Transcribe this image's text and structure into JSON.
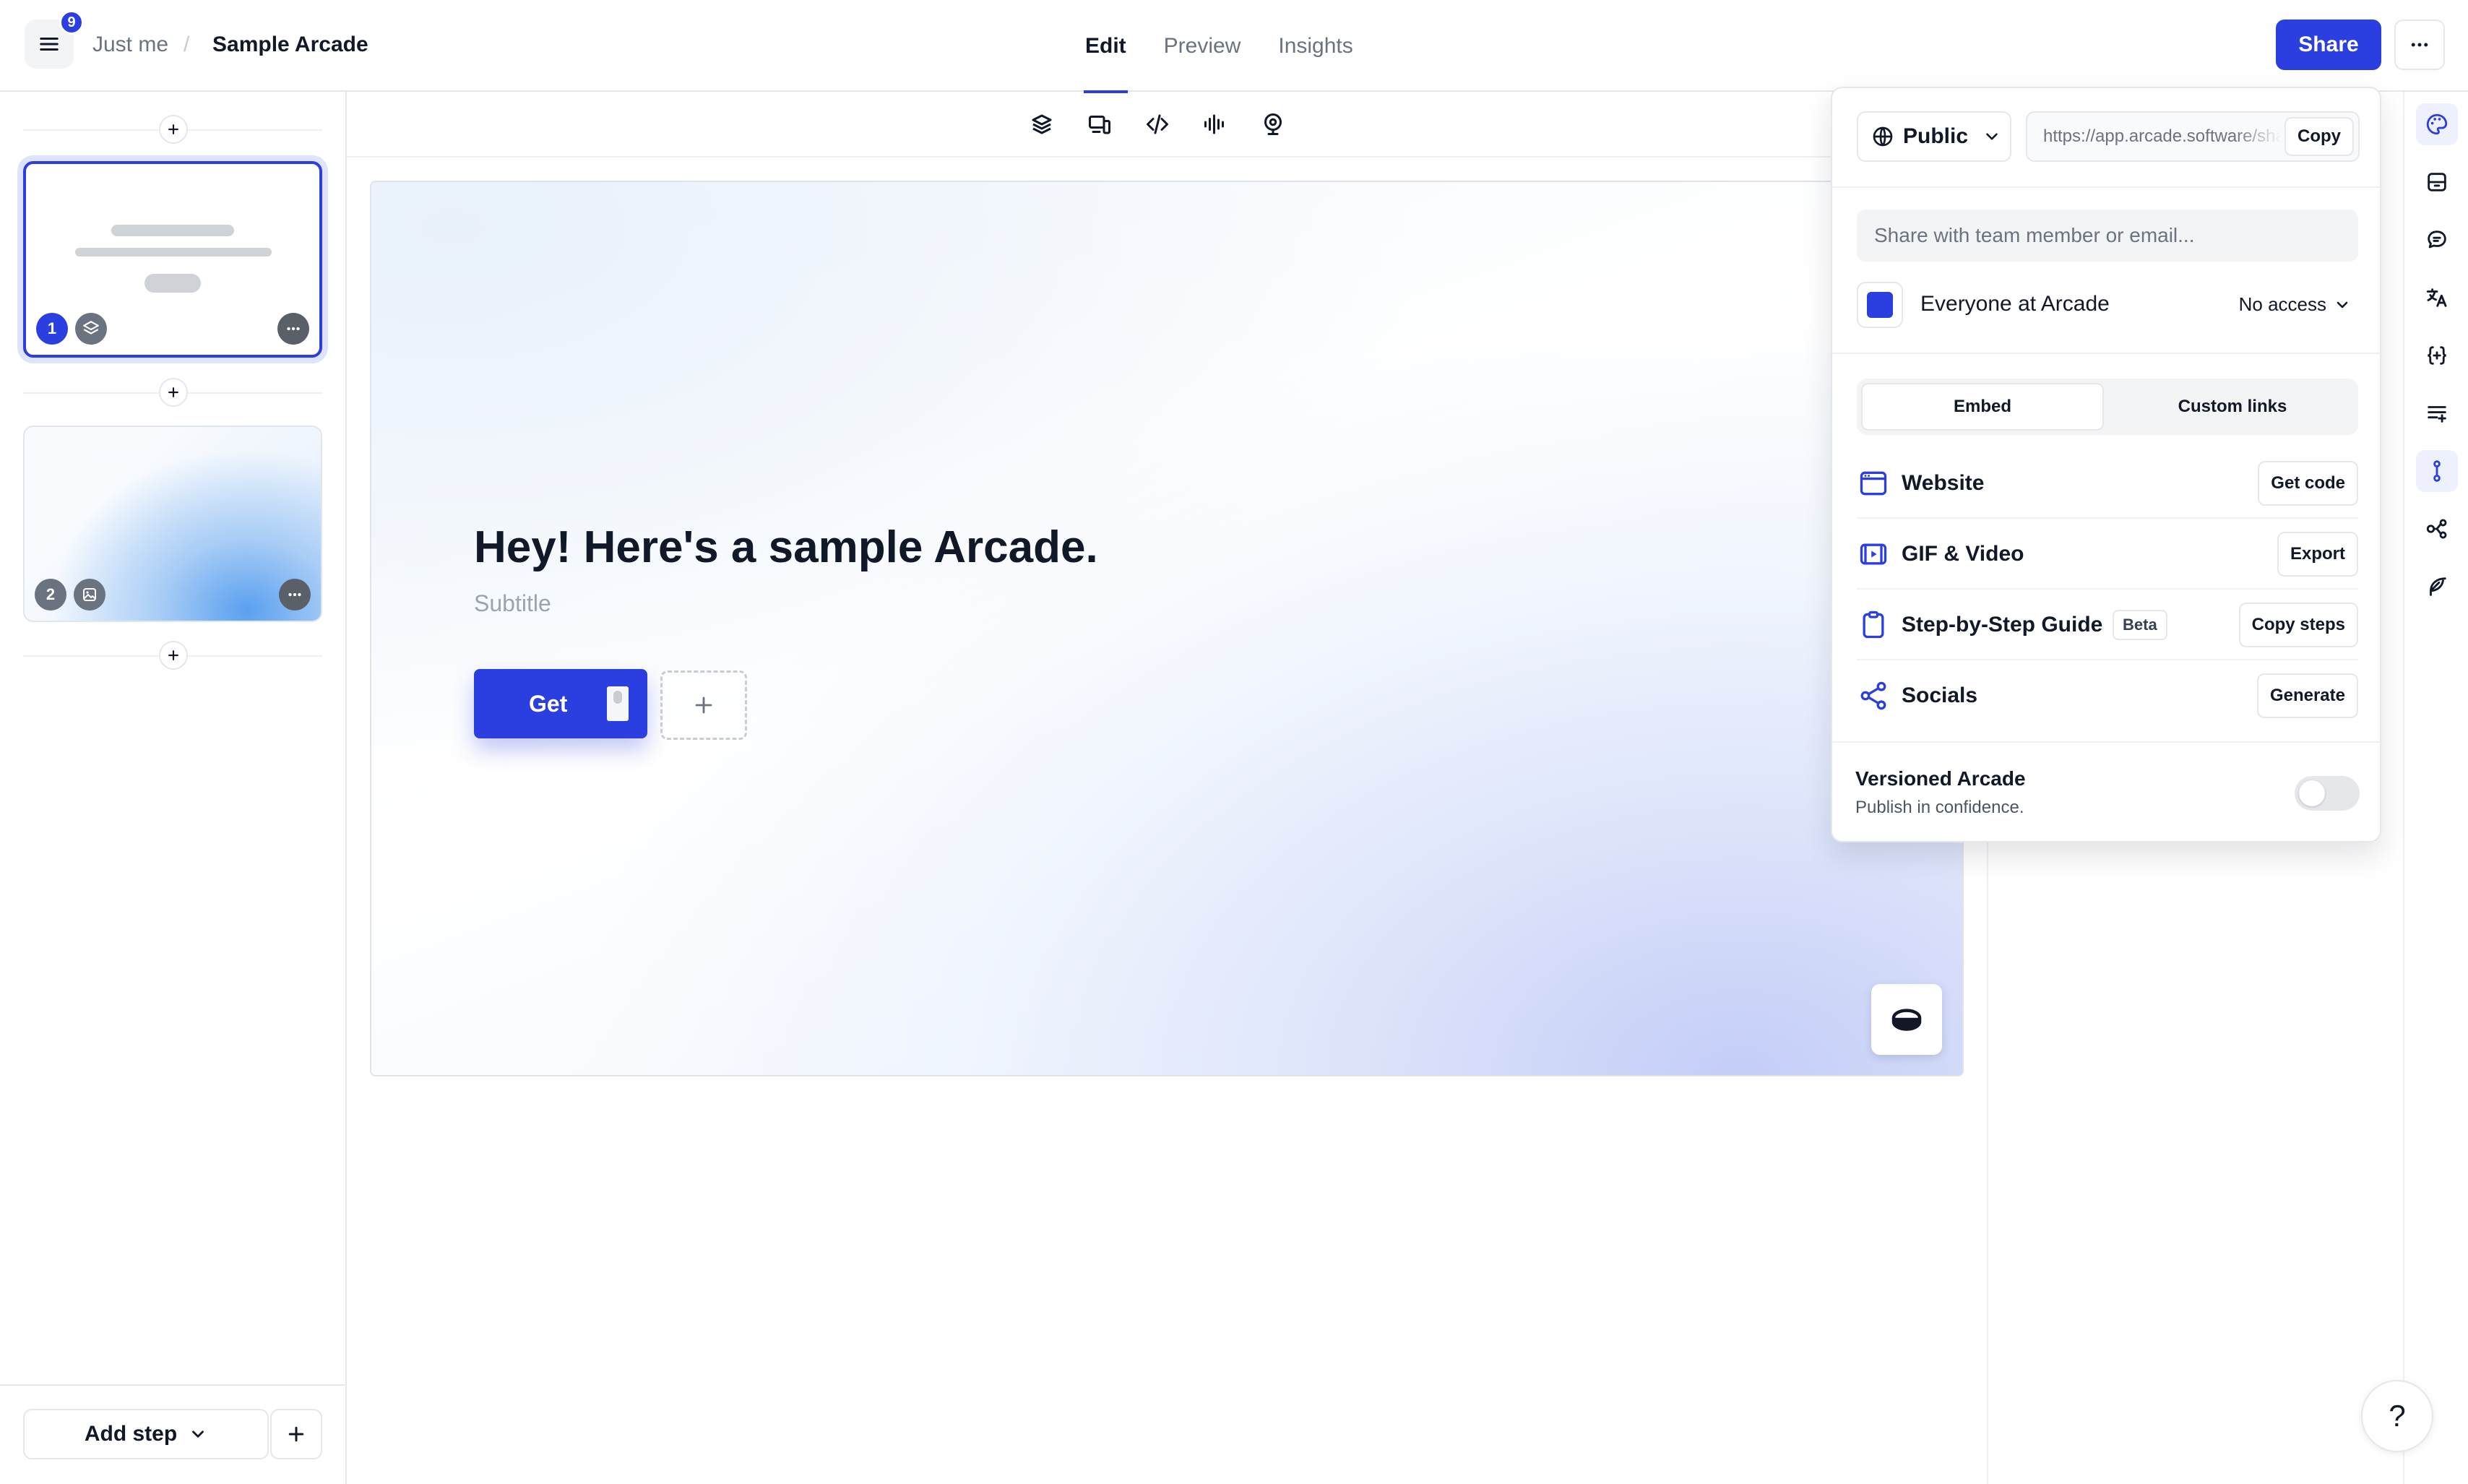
{
  "header": {
    "notification_count": "9",
    "workspace": "Just me",
    "separator": "/",
    "arcade_name": "Sample Arcade",
    "tabs": [
      {
        "label": "Edit",
        "active": true
      },
      {
        "label": "Preview",
        "active": false
      },
      {
        "label": "Insights",
        "active": false
      }
    ],
    "share_label": "Share"
  },
  "sidebar": {
    "steps": [
      {
        "number": "1",
        "selected": true,
        "type_icon": "layers-icon"
      },
      {
        "number": "2",
        "selected": false,
        "type_icon": "image-icon"
      }
    ],
    "add_step_label": "Add step"
  },
  "canvas": {
    "toolbar_icons": [
      "layers-icon",
      "devices-icon",
      "code-icon",
      "audio-waveform-icon",
      "webcam-icon"
    ],
    "title": "Hey! Here's a sample Arcade.",
    "subtitle": "Subtitle",
    "cta_label": "Get"
  },
  "share_popover": {
    "visibility": "Public",
    "url": "https://app.arcade.software/share/sample",
    "copy_label": "Copy",
    "invite_placeholder": "Share with team member or email...",
    "org_name": "Everyone at Arcade",
    "org_access": "No access",
    "tabs": [
      {
        "label": "Embed",
        "active": true
      },
      {
        "label": "Custom links",
        "active": false
      }
    ],
    "options": [
      {
        "label": "Website",
        "action": "Get code",
        "icon": "browser-window-icon"
      },
      {
        "label": "GIF & Video",
        "action": "Export",
        "icon": "video-icon"
      },
      {
        "label": "Step-by-Step Guide",
        "badge": "Beta",
        "action": "Copy steps",
        "icon": "clipboard-icon"
      },
      {
        "label": "Socials",
        "action": "Generate",
        "icon": "share-nodes-icon"
      }
    ],
    "versioned": {
      "title": "Versioned Arcade",
      "subtitle": "Publish in confidence.",
      "enabled": false
    }
  },
  "right_rail": {
    "icons": [
      "palette-icon",
      "archive-icon",
      "comment-icon",
      "translate-icon",
      "variables-icon",
      "chapters-icon",
      "path-icon",
      "flow-icon",
      "feather-icon"
    ],
    "active_icon": "path-icon"
  },
  "help_label": "?",
  "colors": {
    "accent": "#2b3ee0",
    "border": "#e5e7eb",
    "muted_text": "#6b7280"
  }
}
